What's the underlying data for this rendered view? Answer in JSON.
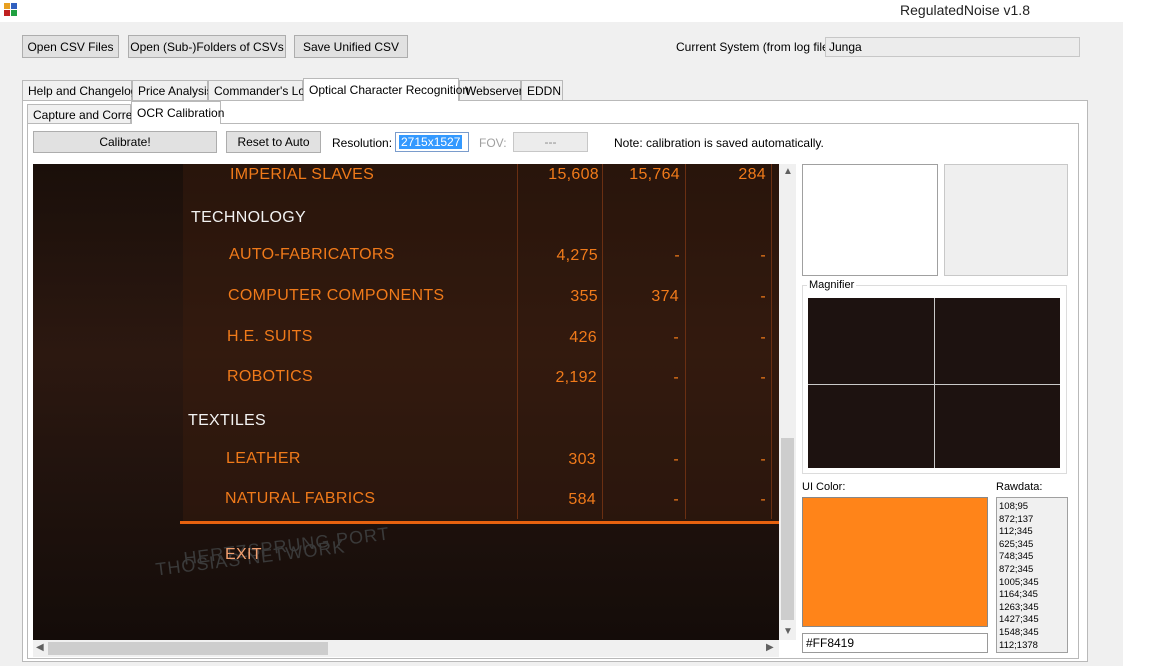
{
  "window": {
    "title": "RegulatedNoise v1.8"
  },
  "toolbar": {
    "open_csv": "Open CSV Files",
    "open_folders": "Open (Sub-)Folders of CSVs",
    "save_unified": "Save Unified CSV",
    "current_system_label": "Current System (from log files)",
    "current_system_value": "Junga"
  },
  "main_tabs": [
    {
      "label": "Help and Changelog"
    },
    {
      "label": "Price Analysis"
    },
    {
      "label": "Commander's Log"
    },
    {
      "label": "Optical Character Recognition"
    },
    {
      "label": "Webserver"
    },
    {
      "label": "EDDN"
    }
  ],
  "sub_tabs": [
    {
      "label": "Capture and Correct"
    },
    {
      "label": "OCR Calibration"
    }
  ],
  "calibration": {
    "calibrate_button": "Calibrate!",
    "reset_button": "Reset to Auto",
    "resolution_label": "Resolution:",
    "resolution_value": "2715x1527",
    "fov_label": "FOV:",
    "fov_value": "---",
    "note": "Note: calibration is saved automatically."
  },
  "screenshot": {
    "rows": [
      {
        "name": "IMPERIAL SLAVES",
        "v1": "15,608",
        "v2": "15,764",
        "v3": "284"
      },
      {
        "heading": "TECHNOLOGY"
      },
      {
        "name": "AUTO-FABRICATORS",
        "v1": "4,275",
        "v2": "-",
        "v3": "-"
      },
      {
        "name": "COMPUTER COMPONENTS",
        "v1": "355",
        "v2": "374",
        "v3": "-"
      },
      {
        "name": "H.E. SUITS",
        "v1": "426",
        "v2": "-",
        "v3": "-"
      },
      {
        "name": "ROBOTICS",
        "v1": "2,192",
        "v2": "-",
        "v3": "-"
      },
      {
        "heading": "TEXTILES"
      },
      {
        "name": "LEATHER",
        "v1": "303",
        "v2": "-",
        "v3": "-"
      },
      {
        "name": "NATURAL FABRICS",
        "v1": "584",
        "v2": "-",
        "v3": "-"
      }
    ],
    "exit_label": "EXIT"
  },
  "magnifier": {
    "label": "Magnifier"
  },
  "ui_color": {
    "label": "UI Color:",
    "hex": "#FF8419"
  },
  "rawdata": {
    "label": "Rawdata:",
    "values": [
      "108;95",
      "872;137",
      "112;345",
      "625;345",
      "748;345",
      "872;345",
      "1005;345",
      "1164;345",
      "1263;345",
      "1427;345",
      "1548;345",
      "112;1378"
    ]
  }
}
